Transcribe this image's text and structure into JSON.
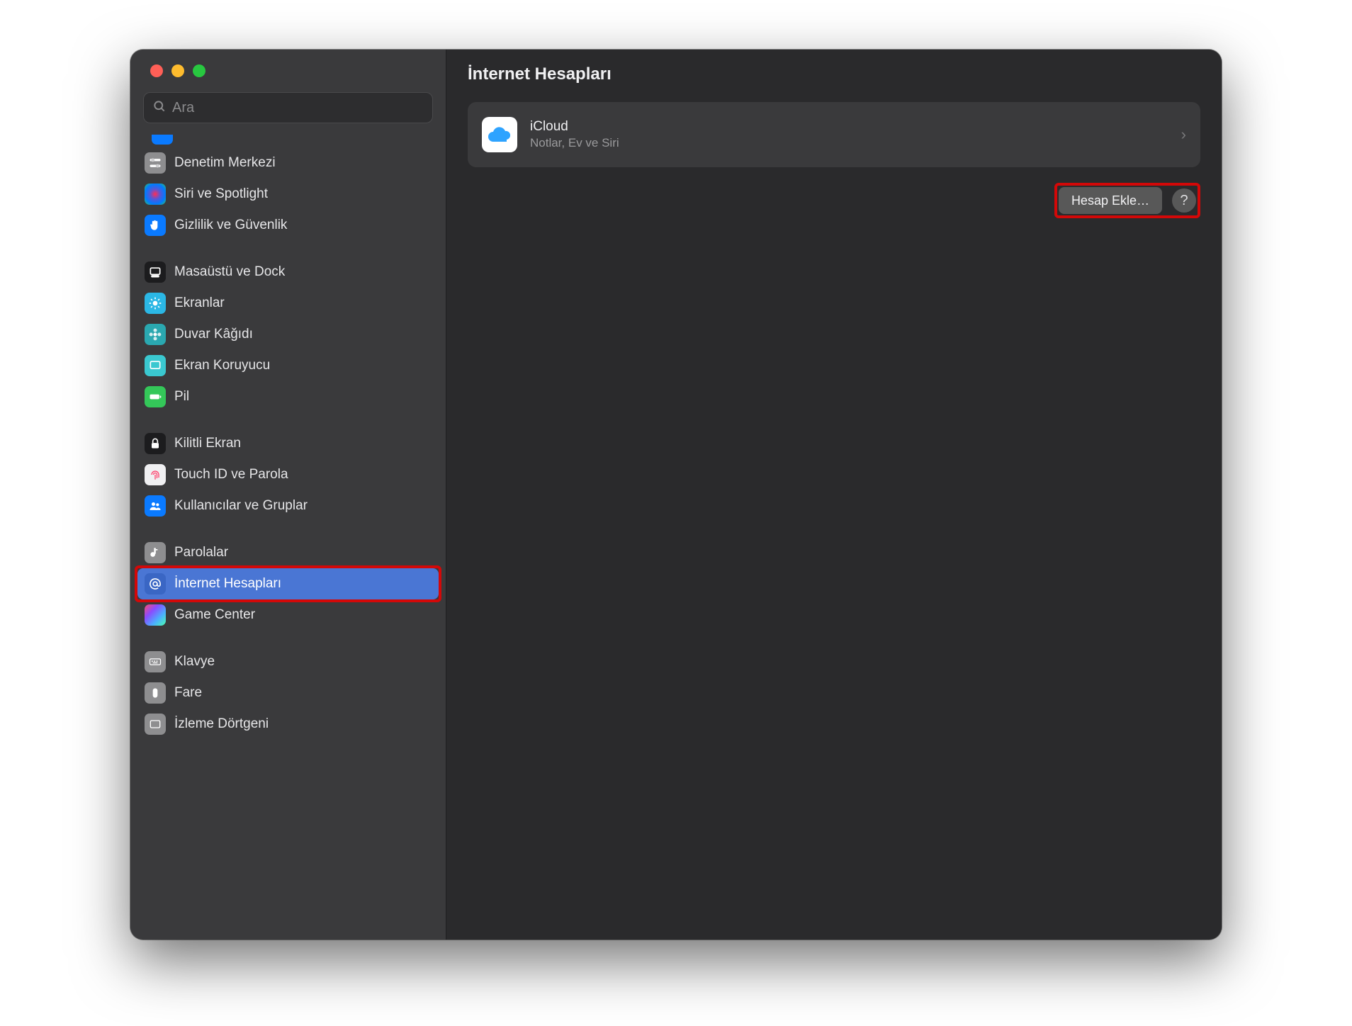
{
  "search": {
    "placeholder": "Ara"
  },
  "sidebar": {
    "items": [
      {
        "label": "Denetim Merkezi"
      },
      {
        "label": "Siri ve Spotlight"
      },
      {
        "label": "Gizlilik ve Güvenlik"
      },
      {
        "label": "Masaüstü ve Dock"
      },
      {
        "label": "Ekranlar"
      },
      {
        "label": "Duvar Kâğıdı"
      },
      {
        "label": "Ekran Koruyucu"
      },
      {
        "label": "Pil"
      },
      {
        "label": "Kilitli Ekran"
      },
      {
        "label": "Touch ID ve Parola"
      },
      {
        "label": "Kullanıcılar ve Gruplar"
      },
      {
        "label": "Parolalar"
      },
      {
        "label": "İnternet Hesapları"
      },
      {
        "label": "Game Center"
      },
      {
        "label": "Klavye"
      },
      {
        "label": "Fare"
      },
      {
        "label": "İzleme Dörtgeni"
      }
    ]
  },
  "main": {
    "title": "İnternet Hesapları",
    "accounts": [
      {
        "title": "iCloud",
        "subtitle": "Notlar, Ev ve Siri"
      }
    ],
    "add_button": "Hesap Ekle…",
    "help": "?"
  }
}
